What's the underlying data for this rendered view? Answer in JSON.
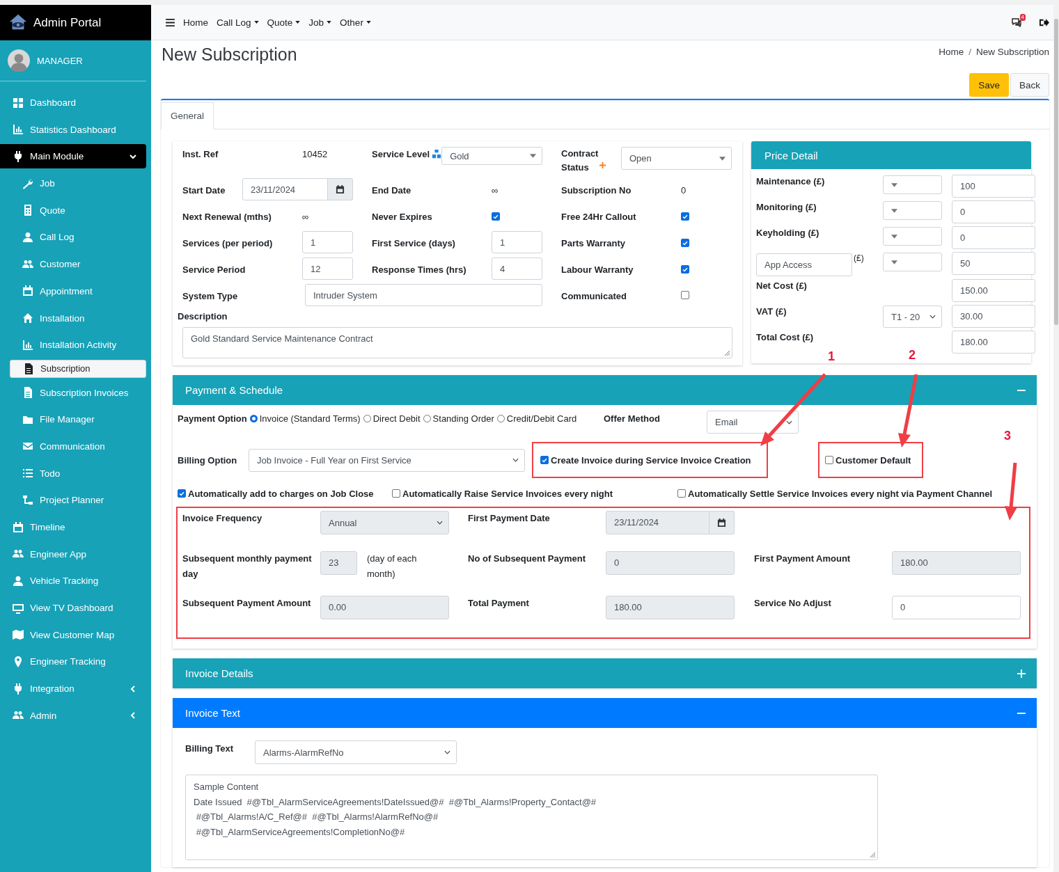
{
  "sidebar": {
    "brand": "Admin Portal",
    "user": "MANAGER",
    "items": [
      {
        "label": "Dashboard",
        "selected": false
      },
      {
        "label": "Statistics Dashboard",
        "selected": false
      },
      {
        "label": "Main Module",
        "selected": false,
        "expanded": true,
        "children": [
          {
            "label": "Job",
            "selected": false
          },
          {
            "label": "Quote",
            "selected": false
          },
          {
            "label": "Call Log",
            "selected": false
          },
          {
            "label": "Customer",
            "selected": false
          },
          {
            "label": "Appointment",
            "selected": false
          },
          {
            "label": "Installation",
            "selected": false
          },
          {
            "label": "Installation Activity",
            "selected": false
          },
          {
            "label": "Subscription",
            "selected": true
          },
          {
            "label": "Subscription Invoices",
            "selected": false
          },
          {
            "label": "File Manager",
            "selected": false
          },
          {
            "label": "Communication",
            "selected": false
          },
          {
            "label": "Todo",
            "selected": false
          },
          {
            "label": "Project Planner",
            "selected": false
          }
        ]
      },
      {
        "label": "Timeline",
        "selected": false
      },
      {
        "label": "Engineer App",
        "selected": false
      },
      {
        "label": "Vehicle Tracking",
        "selected": false
      },
      {
        "label": "View TV Dashboard",
        "selected": false
      },
      {
        "label": "View Customer Map",
        "selected": false
      },
      {
        "label": "Engineer Tracking",
        "selected": false
      },
      {
        "label": "Integration",
        "selected": false,
        "expanded": false
      },
      {
        "label": "Admin",
        "selected": false,
        "expanded": false
      }
    ]
  },
  "navbar": {
    "items": [
      {
        "label": "Home",
        "dropdown": false
      },
      {
        "label": "Call Log",
        "dropdown": true
      },
      {
        "label": "Quote",
        "dropdown": true
      },
      {
        "label": "Job",
        "dropdown": true
      },
      {
        "label": "Other",
        "dropdown": true
      }
    ],
    "notifications": "4"
  },
  "page": {
    "title": "New Subscription",
    "breadcrumb": [
      "Home",
      "New Subscription"
    ],
    "separator": "/",
    "buttons": [
      {
        "label": "Save",
        "kind": "primary"
      },
      {
        "label": "Back",
        "kind": "secondary"
      }
    ]
  },
  "tabs": [
    {
      "label": "General",
      "selected": true
    }
  ],
  "general": {
    "fields": [
      {
        "label": "Inst. Ref",
        "kind": "text",
        "value": "10452",
        "required": false
      },
      {
        "label": "Service Level",
        "kind": "select",
        "value": "Gold",
        "required": false
      },
      {
        "label": "Contract Status",
        "kind": "select",
        "value": "Open",
        "required": true
      },
      {
        "label": "Start Date",
        "kind": "date",
        "value": "23/11/2024",
        "required": false
      },
      {
        "label": "End Date",
        "kind": "text",
        "value": "∞",
        "required": false
      },
      {
        "label": "Subscription No",
        "kind": "text",
        "value": "0",
        "required": false
      },
      {
        "label": "Next Renewal (mths)",
        "kind": "text",
        "value": "∞",
        "required": false
      },
      {
        "label": "Never Expires",
        "kind": "checkbox",
        "checked": true,
        "required": false
      },
      {
        "label": "Free 24Hr Callout",
        "kind": "checkbox",
        "checked": true,
        "required": false
      },
      {
        "label": "Services (per period)",
        "kind": "input",
        "value": "1",
        "required": false
      },
      {
        "label": "First Service (days)",
        "kind": "input",
        "value": "1",
        "required": false
      },
      {
        "label": "Parts Warranty",
        "kind": "checkbox",
        "checked": true,
        "required": false
      },
      {
        "label": "Service Period",
        "kind": "input",
        "value": "12",
        "required": false
      },
      {
        "label": "Response Times (hrs)",
        "kind": "input",
        "value": "4",
        "required": false
      },
      {
        "label": "Labour Warranty",
        "kind": "checkbox",
        "checked": true,
        "required": false
      },
      {
        "label": "System Type",
        "kind": "wide-input",
        "value": "Intruder System",
        "required": false
      },
      {
        "label": "Communicated",
        "kind": "checkbox",
        "checked": false,
        "required": false
      }
    ],
    "description_label": "Description",
    "description": "Gold Standard Service Maintenance Contract"
  },
  "price_detail": {
    "title": "Price Detail",
    "rows": [
      {
        "kind": "select",
        "label": "Maintenance (£)",
        "value": "100"
      },
      {
        "kind": "select",
        "label": "Monitoring (£)",
        "value": "0"
      },
      {
        "kind": "select",
        "label": "Keyholding (£)",
        "value": "0"
      },
      {
        "kind": "custom",
        "label": "App Access",
        "unit": "(£)",
        "value": "50"
      },
      {
        "kind": "plain",
        "label": "Net Cost (£)",
        "value": "150.00"
      },
      {
        "kind": "select",
        "label": "VAT (£)",
        "option": "T1 - 20",
        "value": "30.00"
      },
      {
        "kind": "plain",
        "label": "Total Cost (£)",
        "value": "180.00"
      }
    ]
  },
  "payment": {
    "title": "Payment & Schedule",
    "expanded": true,
    "active": false,
    "payment_option_label": "Payment Option",
    "payment_options": [
      {
        "label": "Invoice (Standard Terms)",
        "selected": true
      },
      {
        "label": "Direct Debit",
        "selected": false
      },
      {
        "label": "Standing Order",
        "selected": false
      },
      {
        "label": "Credit/Debit Card",
        "selected": false
      }
    ],
    "offer_method_label": "Offer Method",
    "offer_method": "Email",
    "billing_option_label": "Billing Option",
    "billing_option": "Job Invoice - Full Year on First Service",
    "highlighted_checks": [
      {
        "label": "Create Invoice during Service Invoice Creation",
        "checked": true
      },
      {
        "label": "Customer Default",
        "checked": false
      }
    ],
    "checks": [
      {
        "label": "Automatically add to charges on Job Close",
        "checked": true
      },
      {
        "label": "Automatically Raise Service Invoices every night",
        "checked": false
      },
      {
        "label": "Automatically Settle Service Invoices every night via Payment Channel",
        "checked": false
      }
    ],
    "schedule": [
      [
        {
          "label": "Invoice Frequency",
          "kind": "select",
          "value": "Annual",
          "readonly": true
        },
        {
          "label": "First Payment Date",
          "kind": "date",
          "value": "23/11/2024",
          "readonly": true
        }
      ],
      [
        {
          "label": "Subsequent monthly payment day",
          "kind": "day",
          "value": "23",
          "note": "(day of each month)",
          "readonly": true
        },
        {
          "label": "No of Subsequent Payment",
          "kind": "input",
          "value": "0",
          "readonly": true
        },
        {
          "label": "First Payment Amount",
          "kind": "input",
          "value": "180.00",
          "readonly": true
        }
      ],
      [
        {
          "label": "Subsequent Payment Amount",
          "kind": "input",
          "value": "0.00",
          "readonly": true
        },
        {
          "label": "Total Payment",
          "kind": "input",
          "value": "180.00",
          "readonly": true
        },
        {
          "label": "Service No Adjust",
          "kind": "input",
          "value": "0",
          "readonly": false
        }
      ]
    ]
  },
  "invoice_details": {
    "title": "Invoice Details",
    "expanded": false,
    "active": false
  },
  "invoice_text": {
    "title": "Invoice Text",
    "expanded": true,
    "active": true,
    "billing_text_label": "Billing Text",
    "billing_text": "Alarms-AlarmRefNo",
    "content": "Sample Content\nDate Issued  #@Tbl_AlarmServiceAgreements!DateIssued@#  #@Tbl_Alarms!Property_Contact@#\n #@Tbl_Alarms!A/C_Ref@#  #@Tbl_Alarms!AlarmRefNo@#\n #@Tbl_AlarmServiceAgreements!CompletionNo@#"
  },
  "annotations": [
    "1",
    "2",
    "3"
  ]
}
